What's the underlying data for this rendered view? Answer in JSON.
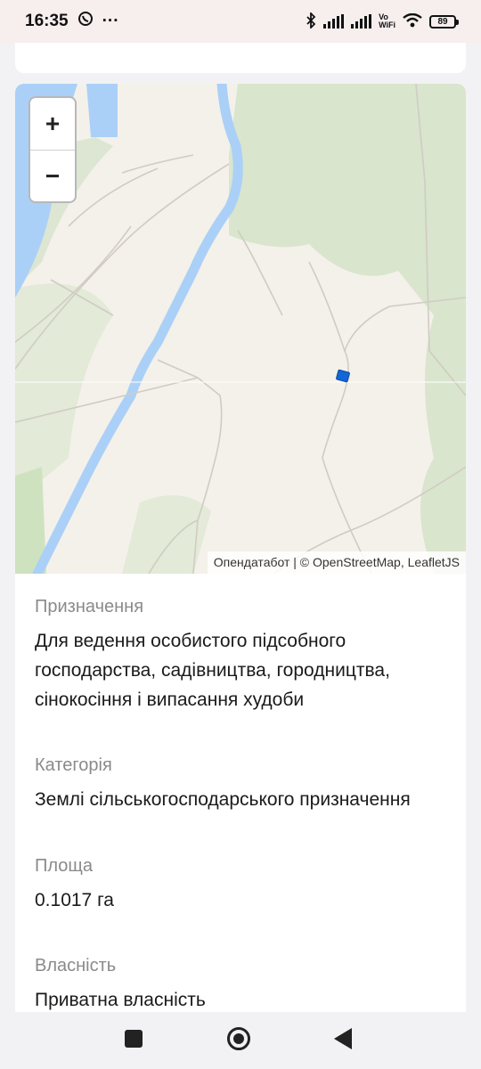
{
  "status_bar": {
    "time": "16:35",
    "more": "···",
    "vo": "Vo",
    "wifi": "WiFi",
    "battery": "89"
  },
  "map": {
    "zoom_in": "+",
    "zoom_out": "−",
    "attribution": "Опендатабот | © OpenStreetMap, LeafletJS",
    "colors": {
      "water": "#abd0f7",
      "forest": "#d9e5cd",
      "land": "#f4f1ea",
      "marker": "#1366d6"
    }
  },
  "details": {
    "purpose_label": "Призначення",
    "purpose_value": "Для ведення особистого підсобного господарства, садівництва, городництва, сінокосіння і випасання худоби",
    "category_label": "Категорія",
    "category_value": "Землі сільськогосподарського призначення",
    "area_label": "Площа",
    "area_value": "0.1017 га",
    "ownership_label": "Власність",
    "ownership_value": "Приватна власність"
  }
}
